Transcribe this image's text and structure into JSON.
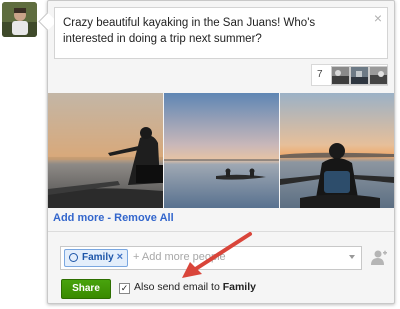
{
  "post": {
    "text": "Crazy beautiful kayaking in the San Juans! Who's interested in doing a trip next summer?",
    "close_icon": "×"
  },
  "attachments": {
    "count": "7"
  },
  "links": {
    "add_more": "Add more",
    "separator": " - ",
    "remove_all": "Remove All"
  },
  "audience": {
    "chip_label": "Family",
    "chip_remove": "×",
    "add_placeholder": "+ Add more people"
  },
  "actions": {
    "share_label": "Share",
    "checkbox_mark": "✓",
    "email_prefix": "Also send email to ",
    "email_target": "Family"
  },
  "colors": {
    "accent_link": "#3366cc",
    "share_green": "#3a8a00",
    "arrow_red": "#d9453a"
  },
  "icons": {
    "audience_circle": "circle-icon",
    "add_person": "add-person-icon",
    "dropdown": "chevron-down-icon",
    "annotation": "red-arrow-icon"
  }
}
